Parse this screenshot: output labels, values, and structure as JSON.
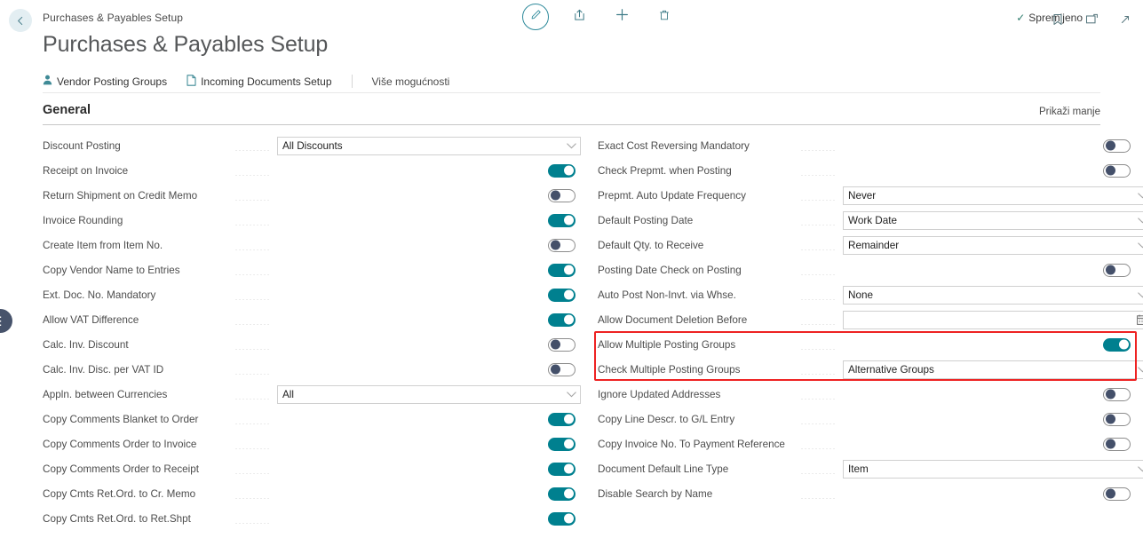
{
  "topbar": {
    "back_icon": "arrow-left-icon",
    "breadcrumb": "Purchases & Payables Setup",
    "actions": [
      {
        "name": "edit-button",
        "icon": "pencil-icon"
      },
      {
        "name": "share-button",
        "icon": "share-icon"
      },
      {
        "name": "new-button",
        "icon": "plus-icon"
      },
      {
        "name": "delete-button",
        "icon": "trash-icon"
      }
    ],
    "save_status": "Spremljeno",
    "save_status_icon": "check-icon",
    "right_icons": [
      {
        "name": "bookmark-button",
        "icon": "bookmark-icon"
      },
      {
        "name": "open-in-new-button",
        "icon": "open-new-window-icon"
      },
      {
        "name": "expand-button",
        "icon": "diagonal-arrow-icon"
      }
    ]
  },
  "page": {
    "title": "Purchases & Payables Setup"
  },
  "ribbon": {
    "items": [
      {
        "label": "Vendor Posting Groups",
        "icon": "person-icon",
        "name": "ribbon-vendor-posting-groups"
      },
      {
        "label": "Incoming Documents Setup",
        "icon": "document-icon",
        "name": "ribbon-incoming-documents-setup"
      }
    ],
    "more_label": "Više mogućnosti"
  },
  "section": {
    "title": "General",
    "show_less_label": "Prikaži manje"
  },
  "colors": {
    "toggle_on": "#00808f",
    "toggle_off_knob": "#44506a",
    "highlight_border": "#ee2222",
    "accent": "#2e8a9b"
  },
  "left_fields": [
    {
      "label": "Discount Posting",
      "type": "select",
      "value": "All Discounts"
    },
    {
      "label": "Receipt on Invoice",
      "type": "toggle",
      "value": "on"
    },
    {
      "label": "Return Shipment on Credit Memo",
      "type": "toggle",
      "value": "off"
    },
    {
      "label": "Invoice Rounding",
      "type": "toggle",
      "value": "on"
    },
    {
      "label": "Create Item from Item No.",
      "type": "toggle",
      "value": "off"
    },
    {
      "label": "Copy Vendor Name to Entries",
      "type": "toggle",
      "value": "on"
    },
    {
      "label": "Ext. Doc. No. Mandatory",
      "type": "toggle",
      "value": "on"
    },
    {
      "label": "Allow VAT Difference",
      "type": "toggle",
      "value": "on"
    },
    {
      "label": "Calc. Inv. Discount",
      "type": "toggle",
      "value": "off"
    },
    {
      "label": "Calc. Inv. Disc. per VAT ID",
      "type": "toggle",
      "value": "off"
    },
    {
      "label": "Appln. between Currencies",
      "type": "select",
      "value": "All"
    },
    {
      "label": "Copy Comments Blanket to Order",
      "type": "toggle",
      "value": "on"
    },
    {
      "label": "Copy Comments Order to Invoice",
      "type": "toggle",
      "value": "on"
    },
    {
      "label": "Copy Comments Order to Receipt",
      "type": "toggle",
      "value": "on"
    },
    {
      "label": "Copy Cmts Ret.Ord. to Cr. Memo",
      "type": "toggle",
      "value": "on"
    },
    {
      "label": "Copy Cmts Ret.Ord. to Ret.Shpt",
      "type": "toggle",
      "value": "on"
    }
  ],
  "right_fields": [
    {
      "label": "Exact Cost Reversing Mandatory",
      "type": "toggle",
      "value": "off"
    },
    {
      "label": "Check Prepmt. when Posting",
      "type": "toggle",
      "value": "off"
    },
    {
      "label": "Prepmt. Auto Update Frequency",
      "type": "select",
      "value": "Never"
    },
    {
      "label": "Default Posting Date",
      "type": "select",
      "value": "Work Date"
    },
    {
      "label": "Default Qty. to Receive",
      "type": "select",
      "value": "Remainder"
    },
    {
      "label": "Posting Date Check on Posting",
      "type": "toggle",
      "value": "off"
    },
    {
      "label": "Auto Post Non-Invt. via Whse.",
      "type": "select",
      "value": "None"
    },
    {
      "label": "Allow Document Deletion Before",
      "type": "date",
      "value": ""
    },
    {
      "label": "Allow Multiple Posting Groups",
      "type": "toggle",
      "value": "on"
    },
    {
      "label": "Check Multiple Posting Groups",
      "type": "select",
      "value": "Alternative Groups"
    },
    {
      "label": "Ignore Updated Addresses",
      "type": "toggle",
      "value": "off"
    },
    {
      "label": "Copy Line Descr. to G/L Entry",
      "type": "toggle",
      "value": "off"
    },
    {
      "label": "Copy Invoice No. To Payment Reference",
      "type": "toggle",
      "value": "off"
    },
    {
      "label": "Document Default Line Type",
      "type": "select",
      "value": "Item"
    },
    {
      "label": "Disable Search by Name",
      "type": "toggle",
      "value": "off"
    }
  ],
  "edge_nub": {
    "icon": "more-vertical-icon",
    "label": "⋮"
  }
}
